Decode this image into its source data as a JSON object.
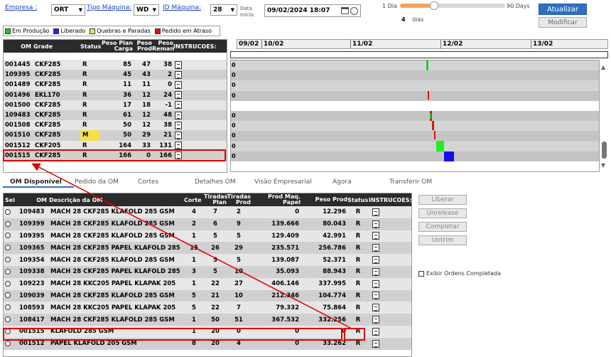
{
  "filters": {
    "empresa_label": "Empresa :",
    "empresa_value": "ORT",
    "tipo_label": "Tipo Máquina:",
    "tipo_value": "WD",
    "id_label": "ID Máquina:",
    "id_value": "28",
    "data_label": "Data\nInício:",
    "data_value": "09/02/2024 18:07"
  },
  "range": {
    "min_label": "1 Dia",
    "max_label": "90 Days",
    "value": "4",
    "unit": "dias",
    "fraction": 0.04
  },
  "buttons": {
    "atualizar": "Atualizar",
    "modificar": "Modificar",
    "liberar": "Liberar",
    "unrelease": "Unrelease",
    "completar": "Completar",
    "untrim": "Untrim"
  },
  "legend": [
    {
      "label": "Em Produção",
      "color": "#22cc22"
    },
    {
      "label": "Liberado",
      "color": "#2222ff"
    },
    {
      "label": "Quebras e Paradas",
      "color": "#f4e04d"
    },
    {
      "label": "Pedido em Atraso",
      "color": "#dd1111"
    }
  ],
  "top_grid": {
    "headers": [
      "OM",
      "Grade",
      "Status",
      "Peso Plan Carga",
      "Peso Prod",
      "Peso Reman",
      "INSTRUCOES:"
    ],
    "rows": [
      [
        "001445",
        "CKF285",
        "R",
        "85",
        "47",
        "38"
      ],
      [
        "109395",
        "CKF285",
        "R",
        "45",
        "43",
        "2"
      ],
      [
        "001489",
        "CKF285",
        "R",
        "11",
        "11",
        "0"
      ],
      [
        "001496",
        "EKL170",
        "R",
        "36",
        "12",
        "24"
      ],
      [
        "001500",
        "CKF285",
        "R",
        "17",
        "18",
        "-1"
      ],
      [
        "109483",
        "CKF285",
        "R",
        "61",
        "12",
        "48"
      ],
      [
        "001508",
        "CKF285",
        "R",
        "50",
        "12",
        "38"
      ],
      [
        "001510",
        "CKF285",
        "M",
        "50",
        "29",
        "21"
      ],
      [
        "001512",
        "CKF205",
        "R",
        "164",
        "33",
        "131"
      ],
      [
        "001515",
        "CKF285",
        "R",
        "166",
        "0",
        "166"
      ]
    ]
  },
  "gantt": {
    "dates": [
      "09/02",
      "10/02",
      "11/02",
      "12/02",
      "13/02"
    ],
    "row_values": [
      "0",
      "0",
      "0",
      "0",
      "",
      "0",
      "0",
      "0",
      "0",
      "0"
    ]
  },
  "tabs": [
    "OM Disponível",
    "Pedido da OM",
    "Cortes",
    "Detalhes OM",
    "Visão Empresarial",
    "Agora",
    "Transferir OM"
  ],
  "bottom_grid": {
    "headers": [
      "Sel",
      "OM",
      "Descrição da OM",
      "Corte",
      "Tiradas Plan",
      "Tiradas Prod",
      "Prod Maq. Papel",
      "Peso Prod",
      "Status",
      "INSTRUCOES:"
    ],
    "rows": [
      [
        "109483",
        "MACH 28 CKF285 KLAFOLD 285 GSM",
        "4",
        "7",
        "2",
        "0",
        "12.296",
        "R"
      ],
      [
        "109399",
        "MACH 28 CKF285 KLAFOLD 285 GSM",
        "2",
        "6",
        "9",
        "139.666",
        "80.043",
        "R"
      ],
      [
        "109395",
        "MACH 28 CKF285 KLAFOLD 285 GSM",
        "1",
        "5",
        "5",
        "129.409",
        "42.991",
        "R"
      ],
      [
        "109365",
        "MACH 28 CKF285 PAPEL KLAFOLD 285",
        "15",
        "26",
        "29",
        "235.571",
        "256.786",
        "R"
      ],
      [
        "109354",
        "MACH 28 CKF285 KLAFOLD 285 GSM",
        "1",
        "5",
        "5",
        "139.087",
        "52.371",
        "R"
      ],
      [
        "109338",
        "MACH 28 CKF285 PAPEL KLAFOLD 285",
        "3",
        "5",
        "10",
        "35.093",
        "88.943",
        "R"
      ],
      [
        "109223",
        "MACH 28 KKC205 PAPEL KLAPAK 205",
        "1",
        "22",
        "27",
        "406.146",
        "337.995",
        "R"
      ],
      [
        "109039",
        "MACH 28 CKF285 KLAFOLD 285 GSM",
        "5",
        "21",
        "10",
        "212.346",
        "104.774",
        "R"
      ],
      [
        "108593",
        "MACH 28 KKC205 PAPEL KLAPAK 205",
        "5",
        "22",
        "7",
        "79.332",
        "75.864",
        "R"
      ],
      [
        "108417",
        "MACH 28 CKF285 KLAFOLD 285 GSM",
        "1",
        "50",
        "51",
        "367.532",
        "332.256",
        "R"
      ],
      [
        "001515",
        "KLAFOLD 285 GSM",
        "1",
        "20",
        "0",
        "0",
        "0",
        "R"
      ],
      [
        "001512",
        "PAPEL KLAFOLD 205 GSM",
        "8",
        "20",
        "4",
        "0",
        "33.262",
        "R"
      ]
    ]
  },
  "exibir_label": "Exibir Ordens Completada"
}
